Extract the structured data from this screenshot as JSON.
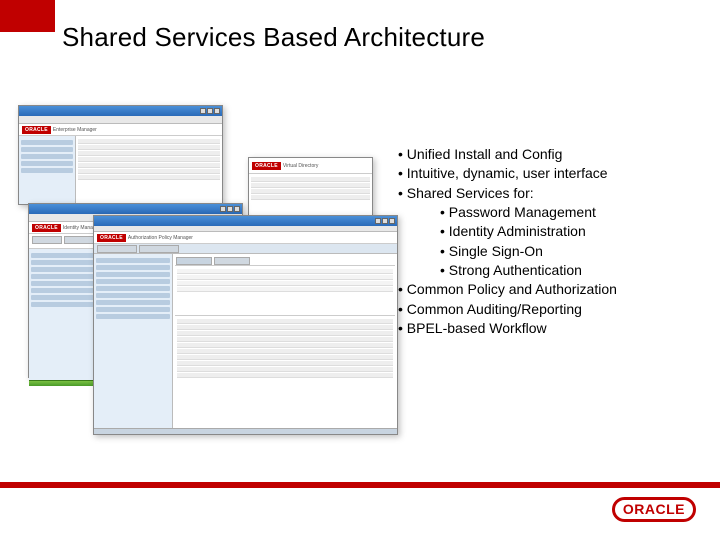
{
  "slide": {
    "title": "Shared Services Based Architecture"
  },
  "bullets": {
    "b1": "Unified Install and Config",
    "b2": "Intuitive, dynamic, user interface",
    "b3": "Shared Services for:",
    "b3a": "Password Management",
    "b3b": "Identity Administration",
    "b3c": "Single Sign-On",
    "b3d": "Strong Authentication",
    "b4": "Common Policy and Authorization",
    "b5": "Common Auditing/Reporting",
    "b6": "BPEL-based Workflow"
  },
  "logo": {
    "brand": "ORACLE"
  },
  "windows": {
    "w1_banner": "Enterprise Manager",
    "w2_banner": "Virtual Directory",
    "w3_banner": "Identity Manager",
    "w4_banner": "Authorization Policy Manager",
    "oracle_small": "ORACLE"
  }
}
